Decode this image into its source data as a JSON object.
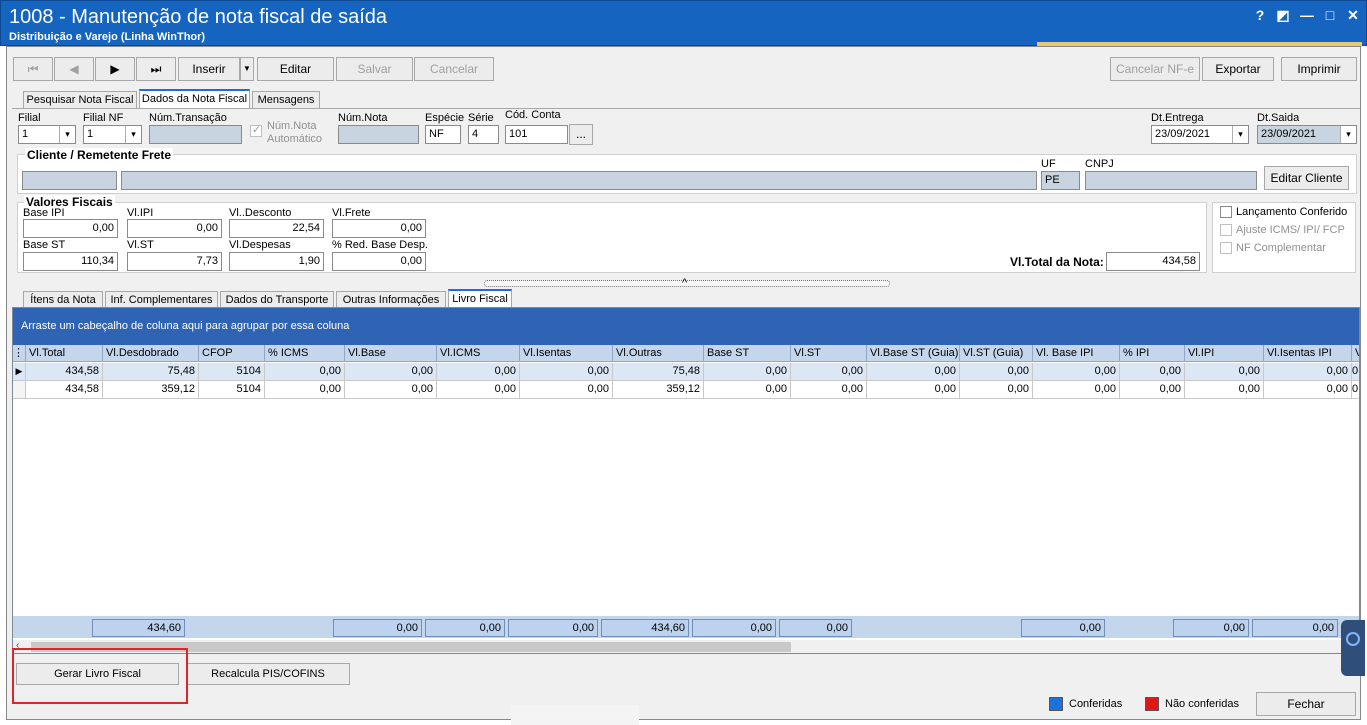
{
  "window": {
    "title": "1008 - Manutenção de nota fiscal de saída",
    "subtitle": "Distribuição e Varejo (Linha WinThor)",
    "controls": [
      "?",
      "◩",
      "—",
      "□",
      "✕"
    ]
  },
  "toolbar": {
    "first": "⏮",
    "prev": "◀",
    "next": "▶",
    "last": "⏭",
    "inserir": "Inserir",
    "inserir_dropdown": "▼",
    "editar": "Editar",
    "salvar": "Salvar",
    "cancelar": "Cancelar",
    "cancelar_nfe": "Cancelar NF-e",
    "exportar": "Exportar",
    "imprimir": "Imprimir"
  },
  "top_tabs": [
    "Pesquisar Nota Fiscal",
    "Dados da Nota Fiscal",
    "Mensagens"
  ],
  "header": {
    "filial_label": "Filial",
    "filial_value": "1",
    "filial_nf_label": "Filial NF",
    "filial_nf_value": "1",
    "num_transacao_label": "Núm.Transação",
    "num_transacao_value": "",
    "num_nota_auto_label1": "Núm.Nota",
    "num_nota_auto_label2": "Automático",
    "num_nota_label": "Núm.Nota",
    "num_nota_value": "",
    "especie_label": "Espécie",
    "especie_value": "NF",
    "serie_label": "Série",
    "serie_value": "4",
    "cod_conta_label": "Cód. Conta",
    "cod_conta_value": "101",
    "cod_conta_btn": "...",
    "dt_entrega_label": "Dt.Entrega",
    "dt_entrega_value": "23/09/2021",
    "dt_saida_label": "Dt.Saida",
    "dt_saida_value": "23/09/2021"
  },
  "cliente": {
    "title": "Cliente / Remetente Frete",
    "uf_label": "UF",
    "uf_value": "PE",
    "cnpj_label": "CNPJ",
    "cnpj_value": "",
    "editar_btn": "Editar Cliente"
  },
  "valores": {
    "title": "Valores Fiscais",
    "base_ipi_label": "Base IPI",
    "base_ipi": "0,00",
    "vl_ipi_label": "Vl.IPI",
    "vl_ipi": "0,00",
    "vl_desconto_label": "Vl..Desconto",
    "vl_desconto": "22,54",
    "vl_frete_label": "Vl.Frete",
    "vl_frete": "0,00",
    "base_st_label": "Base ST",
    "base_st": "110,34",
    "vl_st_label": "Vl.ST",
    "vl_st": "7,73",
    "vl_despesas_label": "Vl.Despesas",
    "vl_despesas": "1,90",
    "red_base_label": "% Red. Base Desp.",
    "red_base": "0,00",
    "total_label": "Vl.Total da Nota:",
    "total": "434,58"
  },
  "flags": {
    "lancamento": "Lançamento Conferido",
    "ajuste": "Ajuste ICMS/ IPI/ FCP",
    "nf_complementar": "NF Complementar"
  },
  "splitter_glyph": "^",
  "bottom_tabs": [
    "Ítens da Nota",
    "Inf. Complementares",
    "Dados do Transporte",
    "Outras Informações",
    "Livro Fiscal"
  ],
  "grid": {
    "group_hint": "Arraste um cabeçalho de coluna aqui para agrupar por essa coluna",
    "columns": [
      "Vl.Total",
      "Vl.Desdobrado",
      "CFOP",
      "% ICMS",
      "Vl.Base",
      "Vl.ICMS",
      "Vl.Isentas",
      "Vl.Outras",
      "Base ST",
      "Vl.ST",
      "Vl.Base ST (Guia)",
      "Vl.ST (Guia)",
      "Vl. Base IPI",
      "% IPI",
      "Vl.IPI",
      "Vl.Isentas IPI",
      "Vl.O"
    ],
    "rows": [
      [
        "434,58",
        "75,48",
        "5104",
        "0,00",
        "0,00",
        "0,00",
        "0,00",
        "75,48",
        "0,00",
        "0,00",
        "0,00",
        "0,00",
        "0,00",
        "0,00",
        "0,00",
        "0,00",
        "0"
      ],
      [
        "434,58",
        "359,12",
        "5104",
        "0,00",
        "0,00",
        "0,00",
        "0,00",
        "359,12",
        "0,00",
        "0,00",
        "0,00",
        "0,00",
        "0,00",
        "0,00",
        "0,00",
        "0,00",
        "0"
      ]
    ],
    "footer": {
      "vl_desdobrado": "434,60",
      "vl_base": "0,00",
      "vl_icms": "0,00",
      "vl_isentas": "0,00",
      "vl_outras": "434,60",
      "base_st": "0,00",
      "vl_st": "0,00",
      "vl_base_ipi": "0,00",
      "vl_ipi": "0,00",
      "vl_isentas_ipi": "0,00"
    }
  },
  "actions": {
    "gerar": "Gerar Livro Fiscal",
    "recalcula": "Recalcula PIS/COFINS"
  },
  "legend": {
    "conferidas": "Conferidas",
    "conferidas_color": "#1a72d8",
    "nao_conferidas": "Não conferidas",
    "nao_conferidas_color": "#e01818"
  },
  "fechar": "Fechar"
}
